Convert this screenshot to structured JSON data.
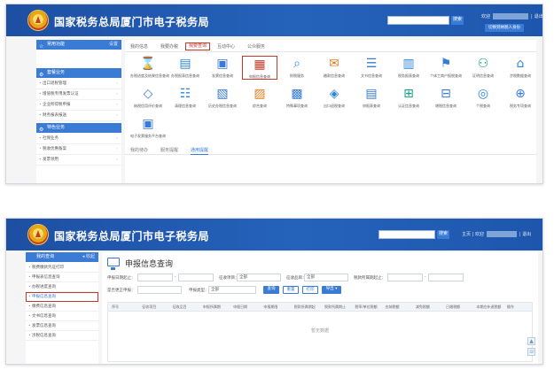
{
  "portal": {
    "title": "国家税务总局厦门市电子税务局"
  },
  "p1": {
    "search_btn": "搜索",
    "welcome": "欢迎",
    "exit": "退出",
    "right_btn": "切换到纳税人身份",
    "side": {
      "head1": "常用功能",
      "head1_extra": "设置",
      "head2": "套餐业务",
      "items2": [
        "出口退税管理",
        "增值税专用发票认证",
        "企业所得税申报",
        "财务报表报送"
      ],
      "head3": "特色业务",
      "items3": [
        "社保业务",
        "税收优惠备案",
        "发票领用"
      ]
    },
    "tabs": [
      "我的信息",
      "我要办税",
      "我要查询",
      "互动中心",
      "公众服务"
    ],
    "icons": [
      "办税进度及结果信息查询",
      "办税报表信息查询",
      "发票信息查询",
      "申报信息查询",
      "财税服务",
      "缴款信息查询",
      "文书信息查询",
      "税务报表查询",
      "个体工商户报税查询",
      "证明信息查询",
      "涉税数据查询",
      "纳税信用评价查询",
      "清理信息查询",
      "历史办税信息查询",
      "综合查询",
      "特殊事项查询",
      "出口退税查询",
      "申报表查询",
      "认证信息查询",
      "增税信息查询",
      "个税查询",
      "税务专项查询",
      "电子发票服务平台查询"
    ],
    "sub_tabs": [
      "我的待办",
      "服务提醒",
      "通用提醒"
    ]
  },
  "p2": {
    "search_btn": "搜索",
    "links": [
      "主页",
      "欢迎",
      "退出"
    ],
    "side": {
      "head": "我的查询",
      "head_extra": "收起",
      "items": [
        "税费缴款凭证打印",
        "申报表信息查询",
        "办税进度查询",
        "申报信息查询",
        "缴费信息查询",
        "文书信息查询",
        "发票信息查询",
        "涉税信息查询"
      ],
      "highlight_index": 3
    },
    "page_title": "申报信息查询",
    "form": {
      "date_label": "申报日期起止：",
      "date_sep": "-",
      "tax_label": "征收项目：",
      "tax_value": "全部",
      "item_label": "征收品目：",
      "item_value": "全部",
      "period_label": "税款所属期起止：",
      "period_sep": "-",
      "corr_label": "是否更正申报：",
      "type_label": "申报类型：",
      "type_value": "全部",
      "btn_query": "查询",
      "btn_reset": "重置",
      "btn_print": "打印",
      "btn_export": "导出"
    },
    "table": {
      "headers": [
        "序号",
        "征收项目",
        "征收品目",
        "申报所属期",
        "申报日期",
        "申报期限",
        "税款所属期起",
        "税款所属期止",
        "税率/单位税额",
        "应纳税额",
        "减免税额",
        "已缴税额",
        "本期应补退税额",
        "操作"
      ],
      "empty": "暂无数据"
    }
  },
  "icons": {
    "float_top": "up-arrow-icon",
    "float_service": "service-icon"
  }
}
